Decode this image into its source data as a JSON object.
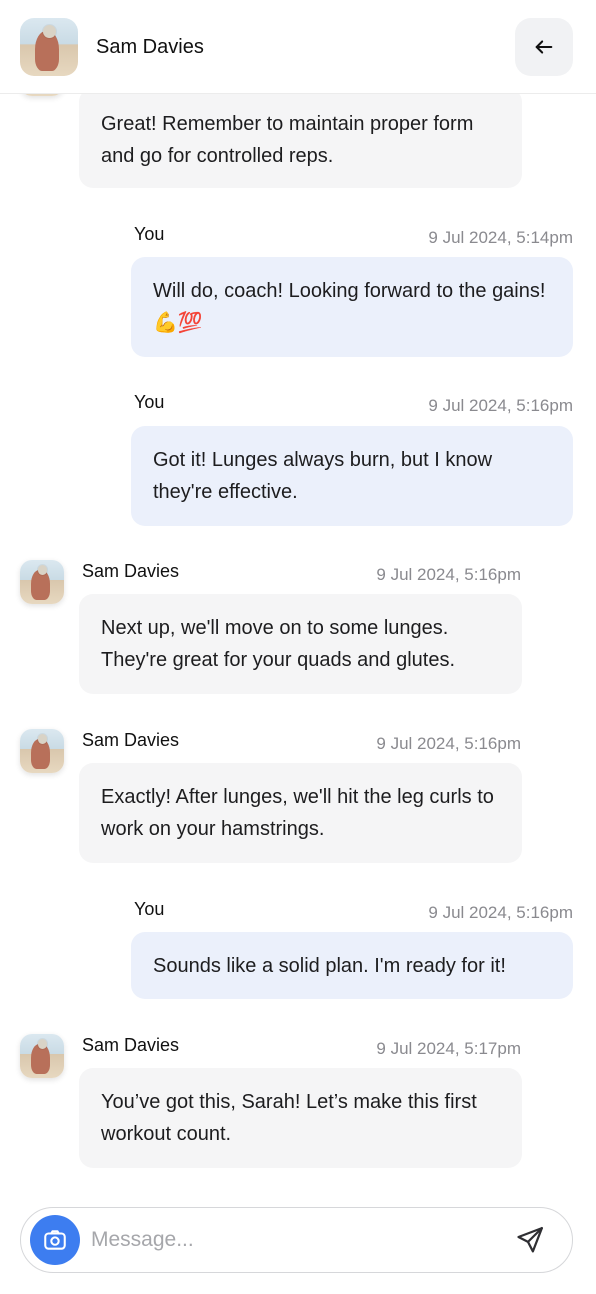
{
  "header": {
    "contact_name": "Sam Davies"
  },
  "messages": [
    {
      "sender": "",
      "time": "",
      "text": "Great! Remember to maintain proper form and go for controlled reps.",
      "direction": "in"
    },
    {
      "sender": "You",
      "time": "9 Jul 2024, 5:14pm",
      "text": "Will do, coach! Looking forward to the gains! 💪💯",
      "direction": "out"
    },
    {
      "sender": "You",
      "time": "9 Jul 2024, 5:16pm",
      "text": "Got it! Lunges always burn, but I know they're effective.",
      "direction": "out"
    },
    {
      "sender": "Sam Davies",
      "time": "9 Jul 2024, 5:16pm",
      "text": "Next up, we'll move on to some lunges. They're great for your quads and glutes.",
      "direction": "in"
    },
    {
      "sender": "Sam Davies",
      "time": "9 Jul 2024, 5:16pm",
      "text": "Exactly! After lunges, we'll hit the leg curls to work on your hamstrings.",
      "direction": "in"
    },
    {
      "sender": "You",
      "time": "9 Jul 2024, 5:16pm",
      "text": "Sounds like a solid plan. I'm ready for it!",
      "direction": "out"
    },
    {
      "sender": "Sam Davies",
      "time": "9 Jul 2024, 5:17pm",
      "text": "You’ve got this, Sarah! Let’s make this first workout count.",
      "direction": "in"
    }
  ],
  "composer": {
    "placeholder": "Message...",
    "value": ""
  },
  "icons": {
    "back": "arrow-left-icon",
    "camera": "camera-icon",
    "send": "send-icon"
  },
  "colors": {
    "accent": "#3d7df0",
    "incoming_bubble": "#f5f5f6",
    "outgoing_bubble": "#ebf0fb"
  }
}
